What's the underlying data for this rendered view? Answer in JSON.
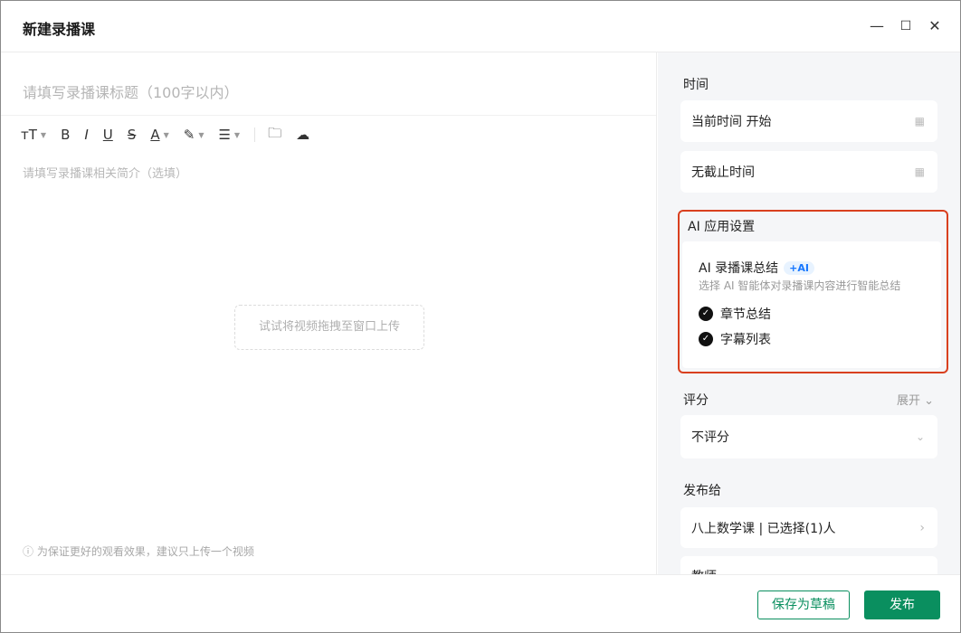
{
  "window": {
    "title": "新建录播课",
    "minimize": "—",
    "maximize": "☐",
    "close": "✕"
  },
  "editor": {
    "title_placeholder": "请填写录播课标题（100字以内）",
    "toolbar": [
      {
        "icon": "font-size-icon",
        "glyph": "ᴛT",
        "caret": true
      },
      {
        "icon": "bold-icon",
        "glyph": "B"
      },
      {
        "icon": "italic-icon",
        "glyph": "I"
      },
      {
        "icon": "underline-icon",
        "glyph": "U"
      },
      {
        "icon": "strikethrough-icon",
        "glyph": "S"
      },
      {
        "icon": "font-color-icon",
        "glyph": "A",
        "caret": true
      },
      {
        "icon": "highlight-icon",
        "glyph": "✎",
        "caret": true
      },
      {
        "icon": "list-icon",
        "glyph": "☰",
        "caret": true
      },
      {
        "icon": "folder-icon",
        "glyph": "🗀"
      },
      {
        "icon": "cloud-icon",
        "glyph": "☁"
      }
    ],
    "desc_placeholder": "请填写录播课相关简介（选填）",
    "drop_hint": "试试将视频拖拽至窗口上传",
    "note": "ⓘ 为保证更好的观看效果，建议只上传一个视频"
  },
  "panel": {
    "time_label": "时间",
    "start": "当前时间 开始",
    "end": "无截止时间",
    "ai": {
      "header": "AI 应用设置",
      "title": "AI 录播课总结",
      "badge": "+AI",
      "desc": "选择 AI 智能体对录播课内容进行智能总结",
      "options": [
        {
          "label": "章节总结",
          "checked": true
        },
        {
          "label": "字幕列表",
          "checked": true
        }
      ],
      "border_color": "#d9401f"
    },
    "score_label": "评分",
    "expand": "展开 ⌄",
    "score_value": "不评分",
    "publish_label": "发布给",
    "publish_value": "八上数学课 | 已选择(1)人",
    "teacher_label": "教师"
  },
  "footer": {
    "draft": "保存为草稿",
    "publish": "发布",
    "accent": "#0a8f5f"
  }
}
